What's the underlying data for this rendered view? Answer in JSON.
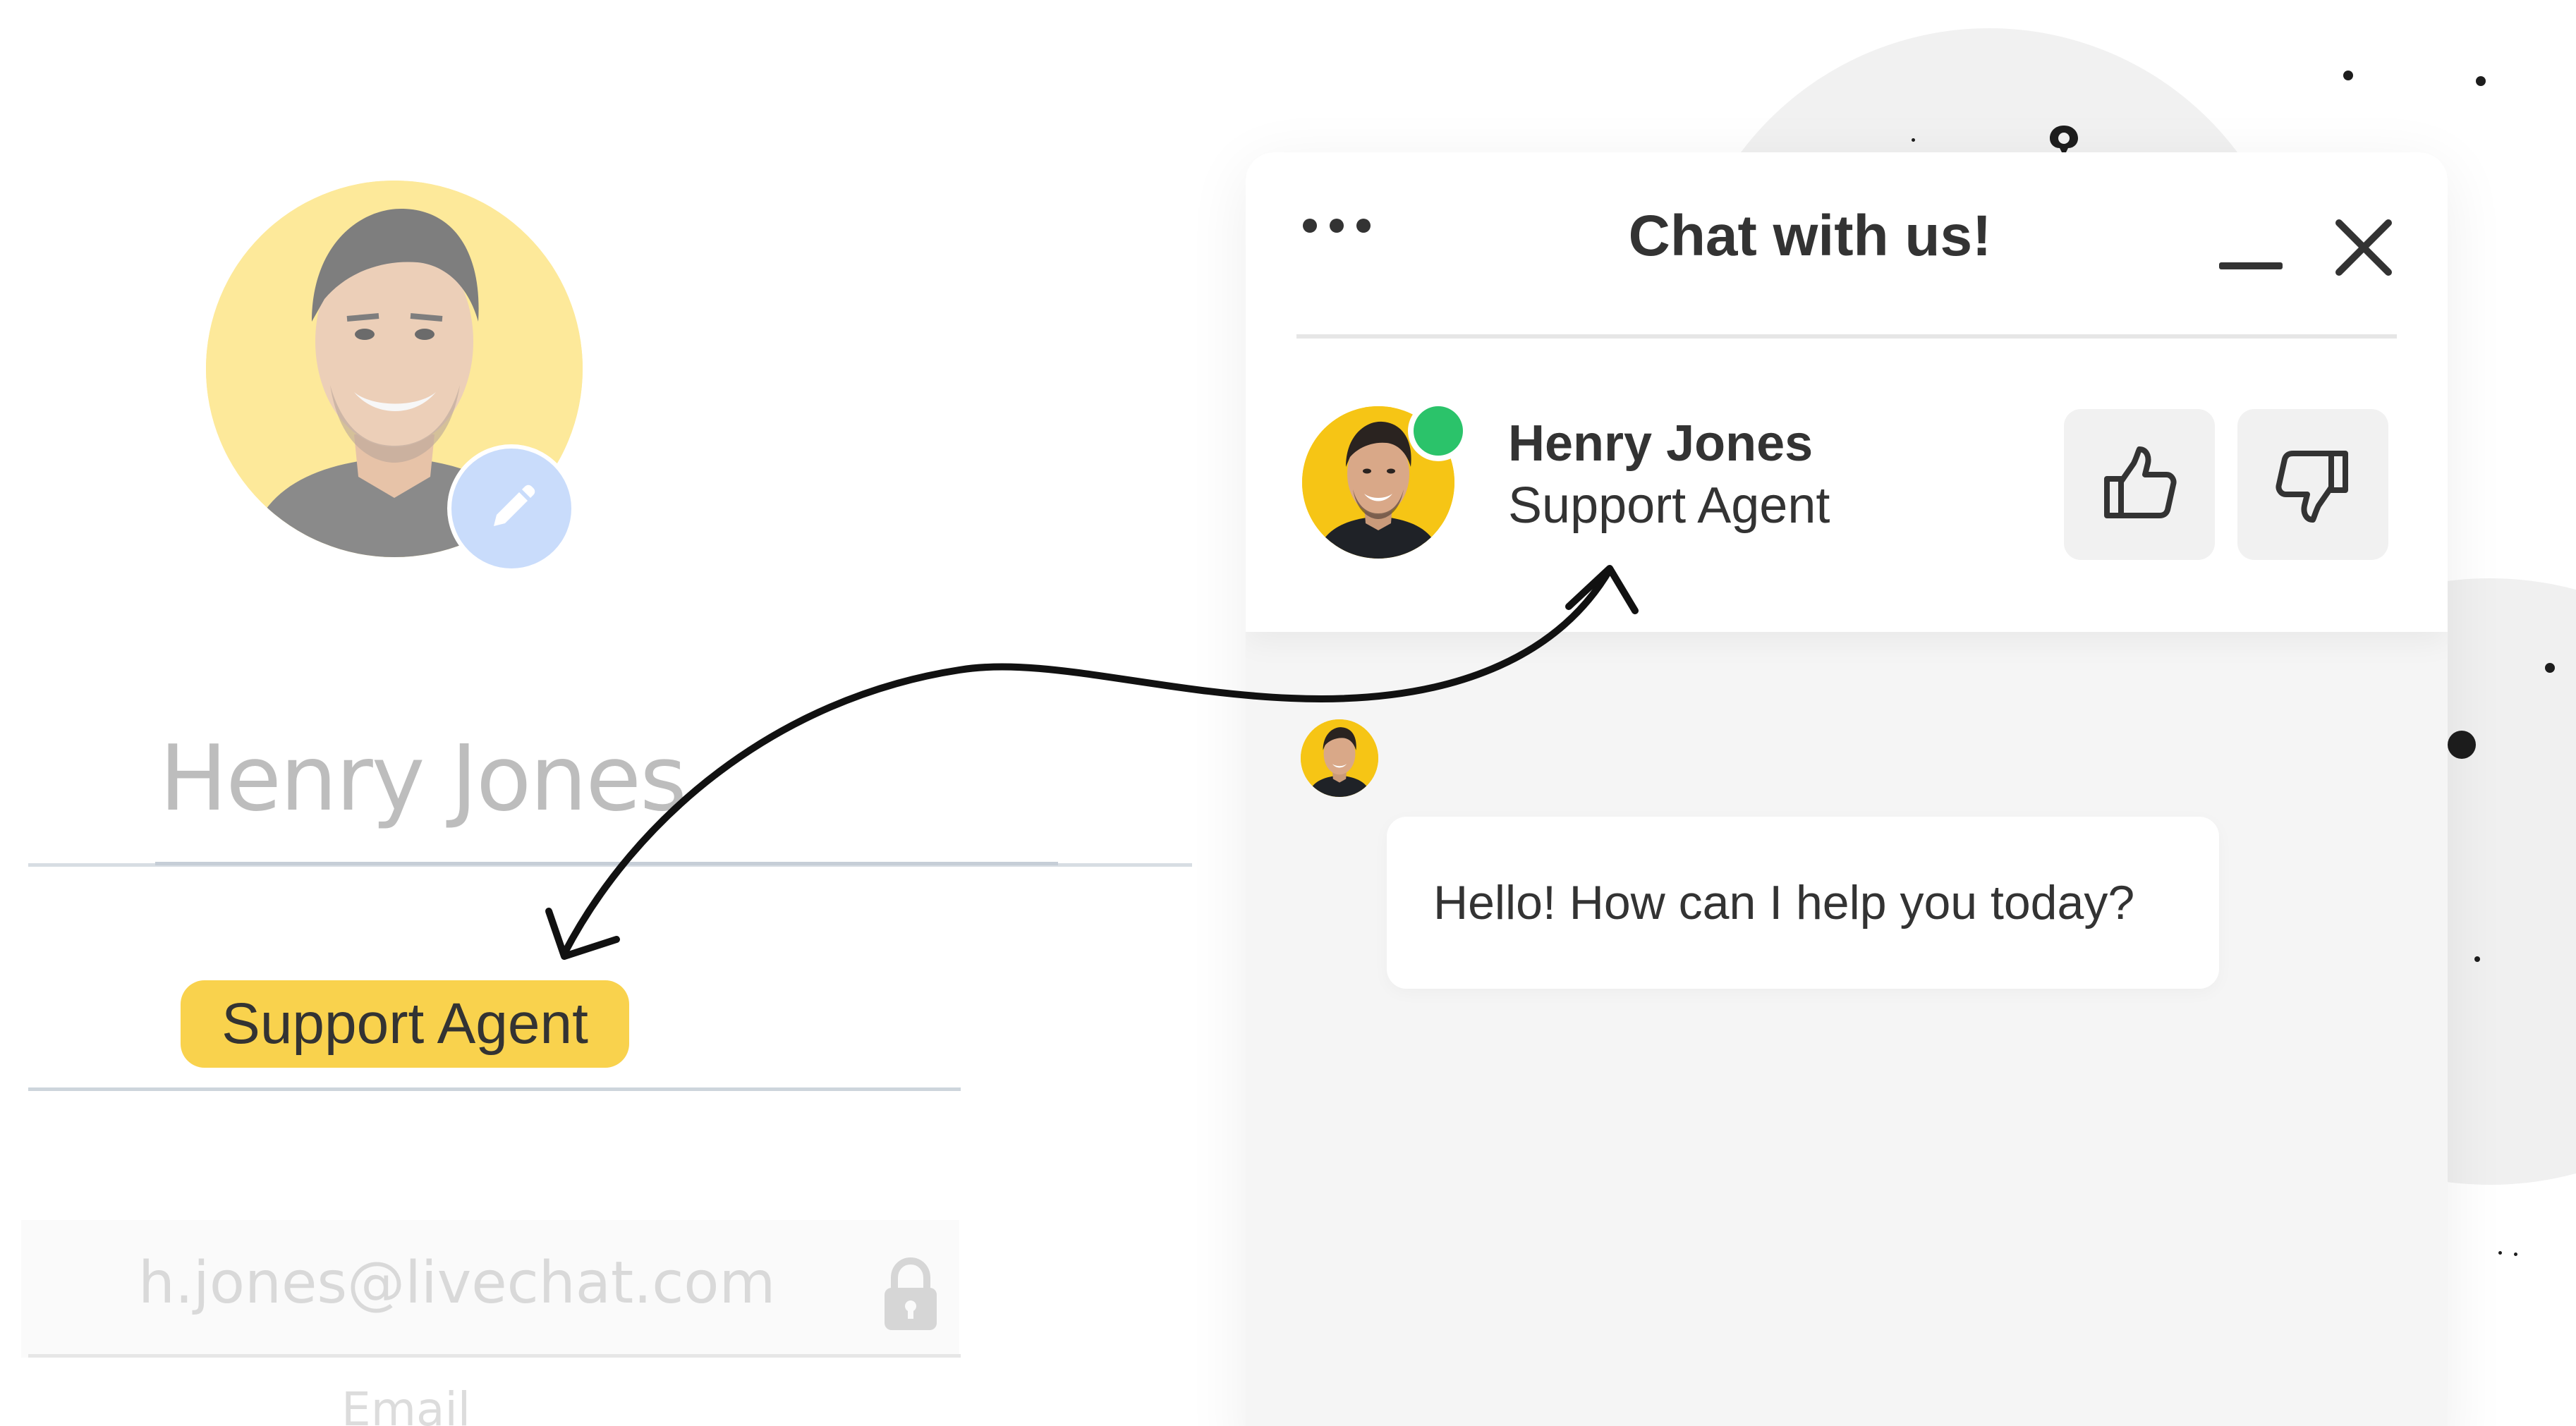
{
  "profile_form": {
    "name_value": "Henry Jones",
    "role_value": "Support Agent",
    "email_value": "h.jones@livechat.com",
    "email_label": "Email",
    "edit_icon": "pencil-icon",
    "lock_icon": "lock-icon"
  },
  "chat_widget": {
    "title": "Chat with us!",
    "menu_icon": "more-horizontal-icon",
    "minimize_icon": "minimize-icon",
    "close_icon": "close-icon",
    "agent": {
      "name": "Henry Jones",
      "role": "Support Agent",
      "status_color": "#2bc36a"
    },
    "rating": {
      "thumbs_up_icon": "thumbs-up-icon",
      "thumbs_down_icon": "thumbs-down-icon"
    },
    "messages": [
      {
        "text": "Hello! How can I help you today?"
      }
    ]
  },
  "colors": {
    "accent_yellow": "#f9d24d",
    "avatar_yellow": "#f6c515",
    "online_green": "#2bc36a",
    "edit_blue": "#c9dcfb",
    "text_dark": "#333333"
  }
}
